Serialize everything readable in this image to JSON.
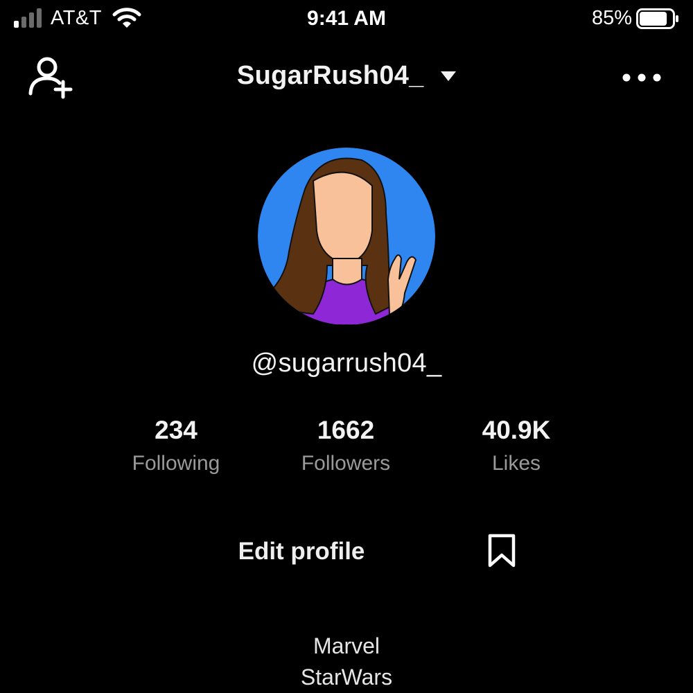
{
  "status_bar": {
    "carrier": "AT&T",
    "time": "9:41 AM",
    "battery_percent": "85%",
    "battery_level": 0.85,
    "signal_bars_active": 1,
    "signal_bars_total": 4
  },
  "header": {
    "username": "SugarRush04_",
    "add_user_icon": "add-user-icon",
    "menu_icon": "more-horizontal-icon",
    "dropdown_icon": "caret-down-icon"
  },
  "profile": {
    "handle": "@sugarrush04_",
    "avatar_colors": {
      "background": "#2f86f0",
      "hair": "#5a3212",
      "skin": "#f9c19a",
      "shirt": "#8e28d6"
    }
  },
  "stats": [
    {
      "value": "234",
      "label": "Following"
    },
    {
      "value": "1662",
      "label": "Followers"
    },
    {
      "value": "40.9K",
      "label": "Likes"
    }
  ],
  "actions": {
    "edit_profile": "Edit profile",
    "bookmark_icon": "bookmark-icon"
  },
  "bio": {
    "lines": [
      "Marvel",
      "StarWars"
    ]
  },
  "colors": {
    "background": "#000000",
    "text_primary": "#f2f2f2",
    "text_secondary": "#9a9a9a"
  }
}
